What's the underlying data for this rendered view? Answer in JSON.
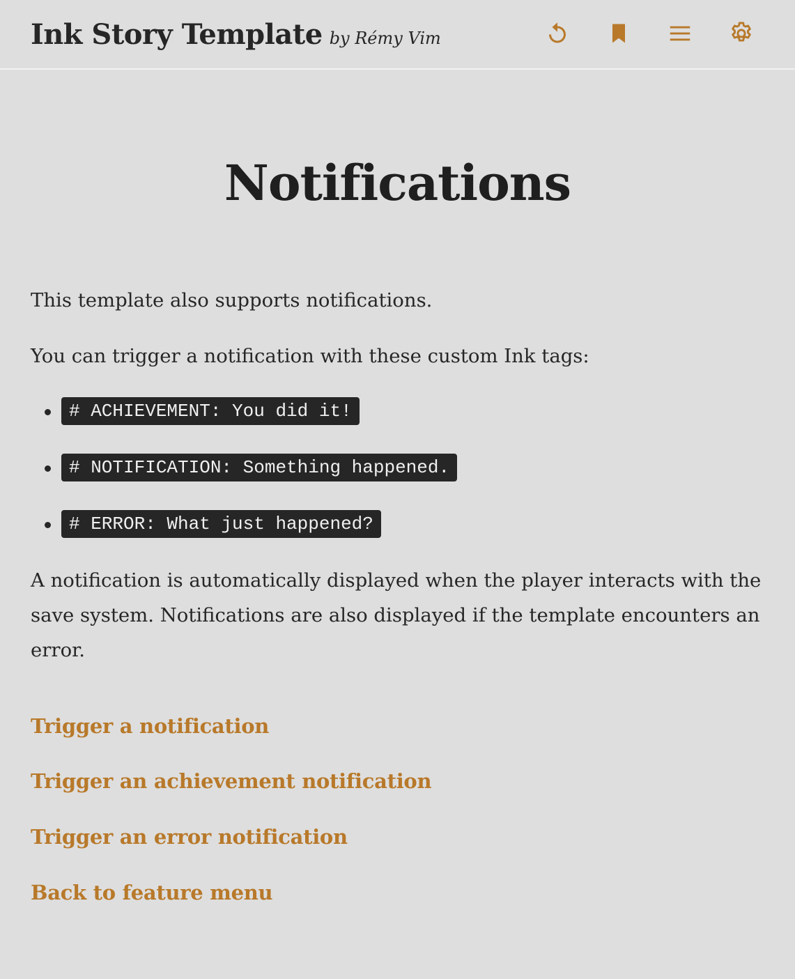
{
  "header": {
    "title": "Ink Story Template",
    "byline": "by Rémy Vim",
    "accent_color": "#b8792a",
    "icons": [
      "restart-icon",
      "bookmark-icon",
      "menu-icon",
      "settings-icon"
    ]
  },
  "main": {
    "heading": "Notifications",
    "intro": "This template also supports notifications.",
    "tags_intro": "You can trigger a notification with these custom Ink tags:",
    "tags": [
      "# ACHIEVEMENT: You did it!",
      "# NOTIFICATION: Something happened.",
      "# ERROR: What just happened?"
    ],
    "explanation": "A notification is automatically displayed when the player interacts with the save system. Notifications are also displayed if the template encounters an error.",
    "choices": [
      "Trigger a notification",
      "Trigger an achievement notification",
      "Trigger an error notification",
      "Back to feature menu"
    ]
  }
}
